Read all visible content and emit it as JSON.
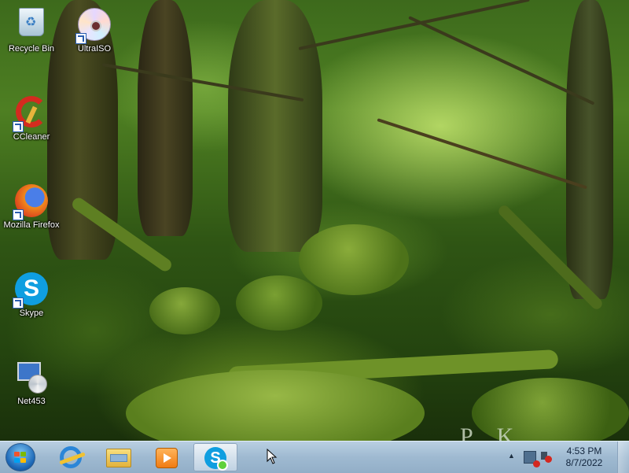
{
  "desktop": {
    "wallpaper": "forest",
    "icons": [
      {
        "label": "Recycle Bin",
        "icon": "recycle-bin-icon"
      },
      {
        "label": "UltraISO",
        "icon": "ultraiso-icon"
      },
      {
        "label": "CCleaner",
        "icon": "ccleaner-icon"
      },
      {
        "label": "Mozilla Firefox",
        "icon": "firefox-icon"
      },
      {
        "label": "Skype",
        "icon": "skype-icon"
      },
      {
        "label": "Net453",
        "icon": "net453-icon"
      }
    ]
  },
  "taskbar": {
    "start_icon": "windows-start-icon",
    "pinned": [
      {
        "icon": "internet-explorer-icon"
      },
      {
        "icon": "windows-explorer-icon"
      },
      {
        "icon": "windows-media-player-icon"
      },
      {
        "icon": "skype-icon",
        "active": true
      }
    ],
    "tray": {
      "show_hidden_icon": "▲",
      "network_status": "disconnected",
      "volume_status": "muted",
      "time": "4:53 PM",
      "date": "8/7/2022"
    }
  },
  "colors": {
    "taskbar": "#a3bed7",
    "skype": "#0f9ee0",
    "error_red": "#d4271f"
  }
}
